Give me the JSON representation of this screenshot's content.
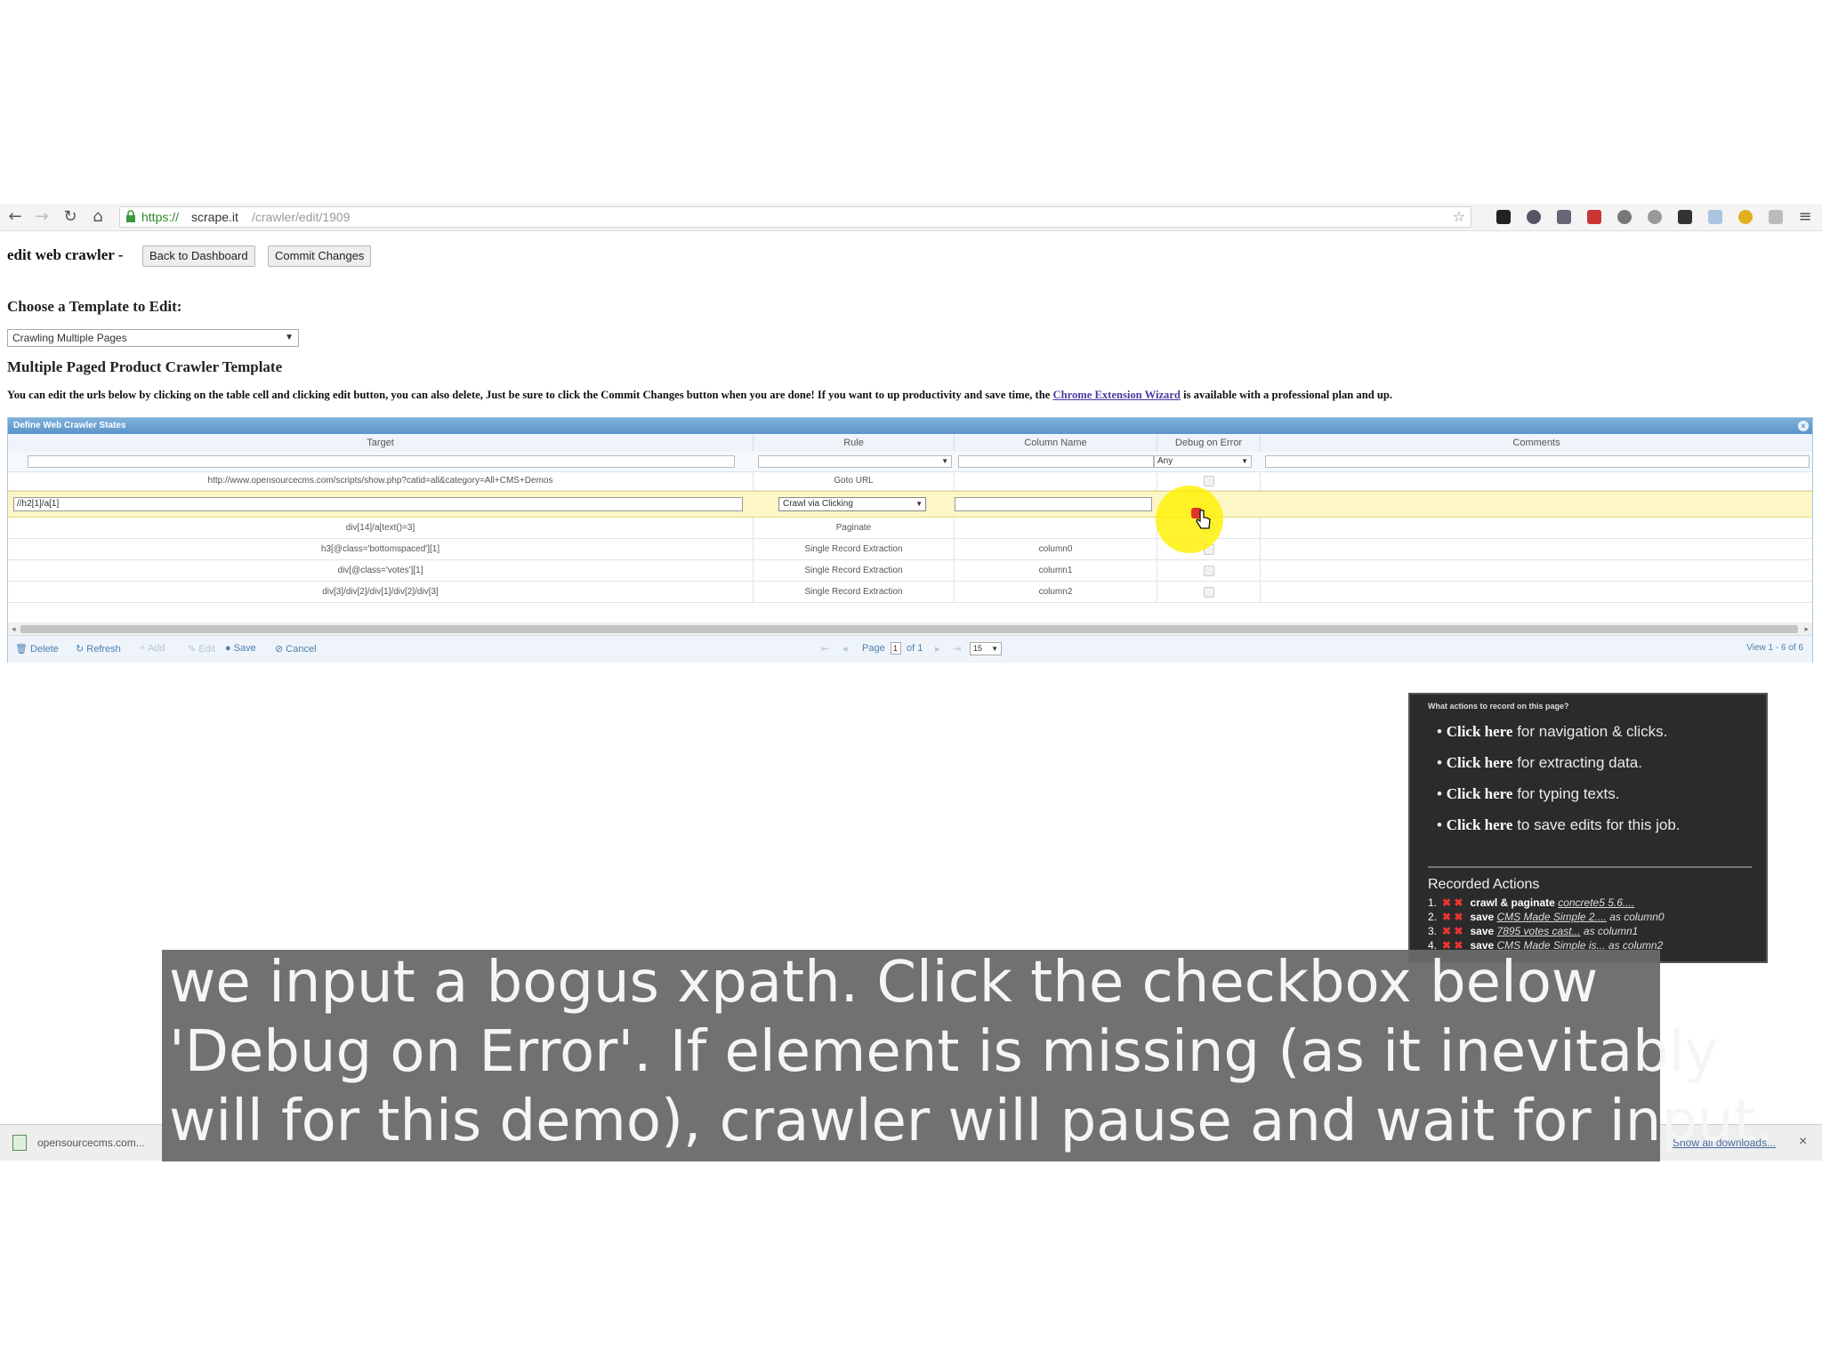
{
  "browser": {
    "url_scheme": "https://",
    "url_host": "scrape.it",
    "url_path": "/crawler/edit/1909",
    "nav_back": "←",
    "nav_forward": "→",
    "nav_reload": "↻",
    "nav_home": "⌂",
    "star": "☆",
    "menu": "≡"
  },
  "page": {
    "title": "edit web crawler -",
    "back_button": "Back to Dashboard",
    "commit_button": "Commit Changes",
    "choose_heading": "Choose a Template to Edit:",
    "template_selected": "Crawling Multiple Pages",
    "template_heading": "Multiple Paged Product Crawler Template",
    "instructions_pre": "You can edit the urls below by clicking on the table cell and clicking edit button, you can also delete, Just be sure to click the Commit Changes button when you are done! If you want to up productivity and save time, the",
    "instructions_link": "Chrome Extension Wizard",
    "instructions_post": "is available with a professional plan and up."
  },
  "grid": {
    "caption": "Define Web Crawler States",
    "columns": [
      "Target",
      "Rule",
      "Column Name",
      "Debug on Error",
      "Comments"
    ],
    "debug_filter": "Any",
    "rows": [
      {
        "target": "http://www.opensourcecms.com/scripts/show.php?catid=all&category=All+CMS+Demos",
        "rule": "Goto URL",
        "column": ""
      },
      {
        "target": "div[14]/a[text()=3]",
        "rule": "Paginate",
        "column": ""
      },
      {
        "target": "h3[@class='bottomspaced'][1]",
        "rule": "Single Record Extraction",
        "column": "column0"
      },
      {
        "target": "div[@class='votes'][1]",
        "rule": "Single Record Extraction",
        "column": "column1"
      },
      {
        "target": "div[3]/div[2]/div[1]/div[2]/div[3]",
        "rule": "Single Record Extraction",
        "column": "column2"
      }
    ],
    "edit_row": {
      "target_value": "//h2[1]/a[1]",
      "rule_value": "Crawl via Clicking"
    },
    "pager": {
      "delete": "Delete",
      "refresh": "Refresh",
      "add": "Add",
      "edit": "Edit",
      "save": "Save",
      "cancel": "Cancel",
      "page_label": "Page",
      "page_value": "1",
      "of_label": "of 1",
      "rows_value": "15",
      "view_info": "View 1 - 6 of 6"
    }
  },
  "helper_panel": {
    "title": "What actions to record on this page?",
    "items": [
      {
        "bold": "Click here",
        "rest": "for navigation & clicks."
      },
      {
        "bold": "Click here",
        "rest": "for extracting data."
      },
      {
        "bold": "Click here",
        "rest": "for typing texts."
      },
      {
        "bold": "Click here",
        "rest": "to save edits for this job."
      }
    ],
    "recorded_title": "Recorded Actions",
    "recorded": [
      {
        "num": "1.",
        "action": "crawl & paginate",
        "link": "concrete5 5.6....",
        "tail": ""
      },
      {
        "num": "2.",
        "action": "save",
        "link": "CMS Made Simple 2....",
        "tail": "as column0"
      },
      {
        "num": "3.",
        "action": "save",
        "link": "7895 votes cast...",
        "tail": "as column1"
      },
      {
        "num": "4.",
        "action": "save",
        "link": "CMS Made Simple is...",
        "tail": "as column2"
      }
    ]
  },
  "download_bar": {
    "file": "opensourcecms.com...",
    "show_all": "Show all downloads...",
    "close": "×"
  },
  "subtitle": {
    "lines": [
      "we input a bogus xpath. Click the checkbox below",
      "'Debug on Error'. If element is missing (as it inevitably",
      "will for this demo), crawler will pause and wait for input."
    ]
  },
  "colors": {
    "grid_header": "#5c95c8",
    "edit_row": "#fdf6c7",
    "highlight": "#fff000",
    "checked": "#e0332a"
  }
}
